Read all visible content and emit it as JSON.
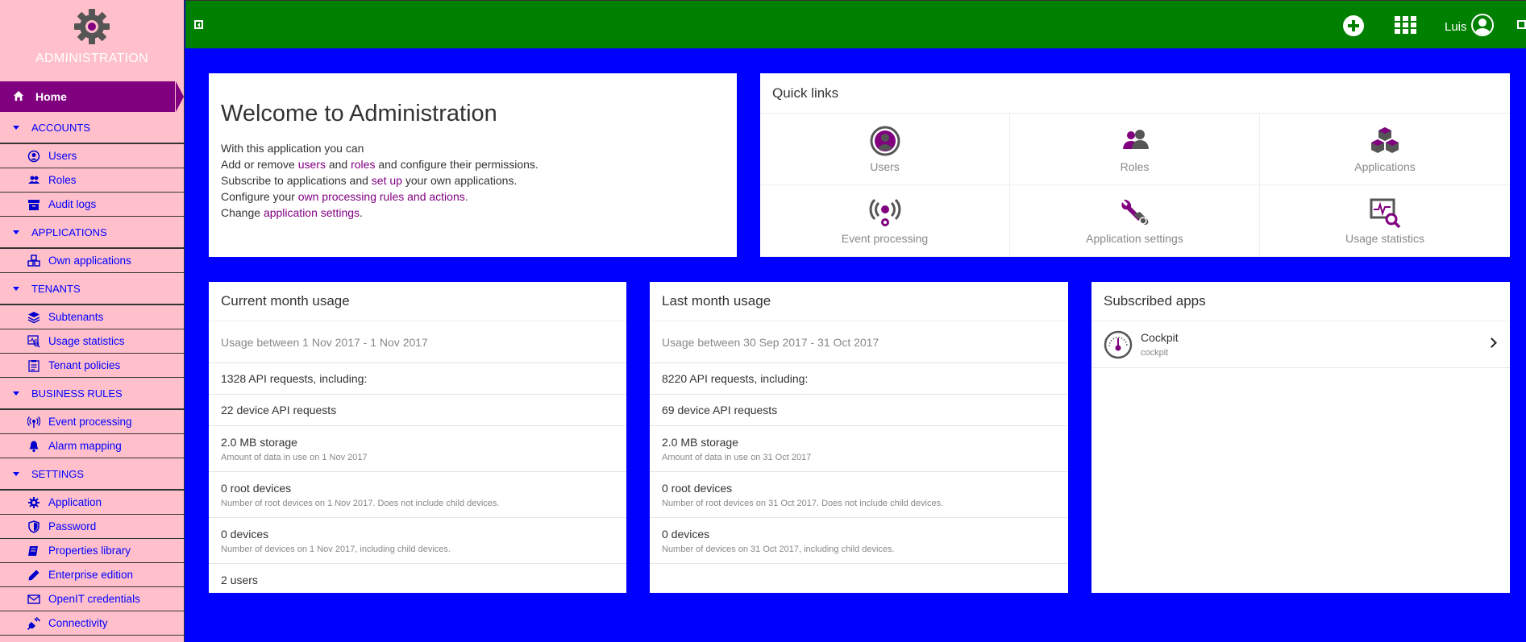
{
  "brand": {
    "title": "ADMINISTRATION"
  },
  "sidebar": {
    "home": "Home",
    "sections": [
      {
        "label": "ACCOUNTS",
        "items": [
          {
            "label": "Users",
            "icon": "user-circle-icon"
          },
          {
            "label": "Roles",
            "icon": "users-icon"
          },
          {
            "label": "Audit logs",
            "icon": "archive-icon"
          }
        ]
      },
      {
        "label": "APPLICATIONS",
        "items": [
          {
            "label": "Own applications",
            "icon": "cubes-icon"
          }
        ]
      },
      {
        "label": "TENANTS",
        "items": [
          {
            "label": "Subtenants",
            "icon": "layers-icon"
          },
          {
            "label": "Usage statistics",
            "icon": "usage-stats-icon"
          },
          {
            "label": "Tenant policies",
            "icon": "policy-icon"
          }
        ]
      },
      {
        "label": "BUSINESS RULES",
        "items": [
          {
            "label": "Event processing",
            "icon": "broadcast-icon"
          },
          {
            "label": "Alarm mapping",
            "icon": "bell-icon"
          }
        ]
      },
      {
        "label": "SETTINGS",
        "items": [
          {
            "label": "Application",
            "icon": "gear-icon"
          },
          {
            "label": "Password",
            "icon": "shield-icon"
          },
          {
            "label": "Properties library",
            "icon": "book-icon"
          },
          {
            "label": "Enterprise edition",
            "icon": "pencil-icon"
          },
          {
            "label": "OpenIT credentials",
            "icon": "envelope-icon"
          },
          {
            "label": "Connectivity",
            "icon": "plug-icon"
          }
        ]
      }
    ]
  },
  "topbar": {
    "user_name": "Luis"
  },
  "welcome": {
    "title": "Welcome to Administration",
    "line1": "With this application you can",
    "line2_a": "Add or remove ",
    "line2_link1": "users",
    "line2_b": " and ",
    "line2_link2": "roles",
    "line2_c": " and configure their permissions.",
    "line3_a": "Subscribe to applications and ",
    "line3_link": "set up",
    "line3_b": " your own applications.",
    "line4_a": "Configure your ",
    "line4_link": "own processing rules and actions",
    "line4_b": ".",
    "line5_a": "Change ",
    "line5_link": "application settings",
    "line5_b": "."
  },
  "quick_links": {
    "title": "Quick links",
    "items": [
      {
        "label": "Users",
        "icon": "user-circle-icon"
      },
      {
        "label": "Roles",
        "icon": "users-icon"
      },
      {
        "label": "Applications",
        "icon": "cubes-icon"
      },
      {
        "label": "Event processing",
        "icon": "broadcast-gear-icon"
      },
      {
        "label": "Application settings",
        "icon": "wrench-icon"
      },
      {
        "label": "Usage statistics",
        "icon": "usage-stats-icon"
      }
    ]
  },
  "current_usage": {
    "title": "Current month usage",
    "period": "Usage between 1 Nov 2017 - 1 Nov 2017",
    "api": "1328 API requests, including:",
    "device_api": "22 device API requests",
    "storage": "2.0 MB storage",
    "storage_sub": "Amount of data in use on 1 Nov 2017",
    "root_devices": "0 root devices",
    "root_devices_sub": "Number of root devices on 1 Nov 2017. Does not include child devices.",
    "devices": "0 devices",
    "devices_sub": "Number of devices on 1 Nov 2017, including child devices.",
    "users": "2 users"
  },
  "last_usage": {
    "title": "Last month usage",
    "period": "Usage between 30 Sep 2017 - 31 Oct 2017",
    "api": "8220 API requests, including:",
    "device_api": "69 device API requests",
    "storage": "2.0 MB storage",
    "storage_sub": "Amount of data in use on 31 Oct 2017",
    "root_devices": "0 root devices",
    "root_devices_sub": "Number of root devices on 31 Oct 2017. Does not include child devices.",
    "devices": "0 devices",
    "devices_sub": "Number of devices on 31 Oct 2017, including child devices."
  },
  "subscribed": {
    "title": "Subscribed apps",
    "apps": [
      {
        "name": "Cockpit",
        "slug": "cockpit",
        "icon": "gauge-icon"
      }
    ]
  },
  "colors": {
    "sidebar": "#ffc0cb",
    "topbar": "#008000",
    "background": "#0000ff",
    "accent": "#800080"
  }
}
